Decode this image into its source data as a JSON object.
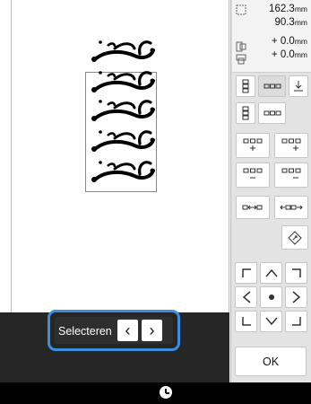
{
  "info": {
    "width": "162.3",
    "height": "90.3",
    "offset_x": "+ 0.0",
    "offset_y": "+ 0.0",
    "unit": "mm"
  },
  "select": {
    "label": "Selecteren"
  },
  "ok_label": "OK",
  "colors": {
    "accent": "#3b8fe0",
    "panel": "#e3e3e3",
    "dark": "#262626"
  },
  "icons": [
    "size-icon",
    "position-x-icon",
    "position-y-icon",
    "vertical-layout-icon",
    "horizontal-layout-icon",
    "pin-icon",
    "add-rows-icon",
    "add-columns-icon",
    "remove-rows-icon",
    "remove-columns-icon",
    "spacing-icon",
    "widen-icon",
    "rotate-icon",
    "arrow-icons",
    "center-dot-icon",
    "clock-icon"
  ]
}
